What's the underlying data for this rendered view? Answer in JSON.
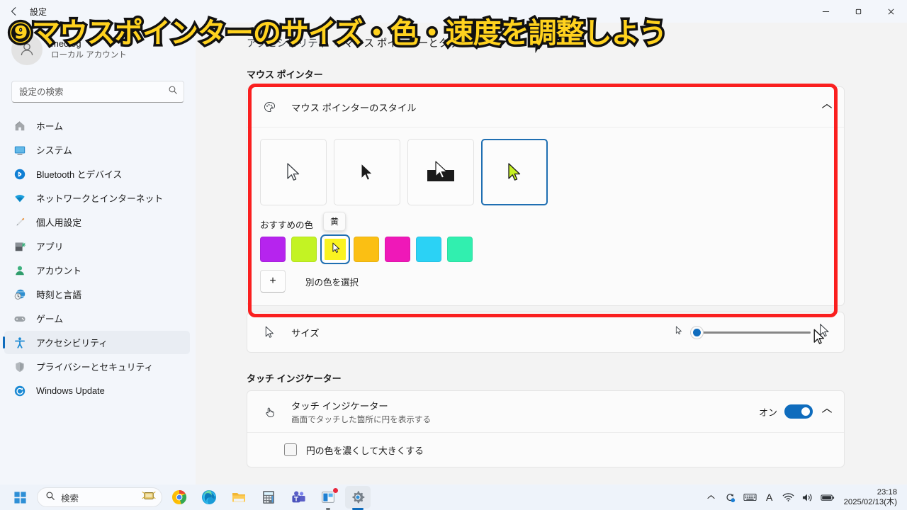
{
  "window": {
    "title": "設定",
    "back_icon": "back-arrow-icon",
    "controls": {
      "minimize": "—",
      "maximize": "❐",
      "close": "✕"
    }
  },
  "overlay": {
    "title": "⑨マウスポインターのサイズ・色・速度を調整しよう",
    "text_color": "#ffd21e",
    "stroke_color": "#111111"
  },
  "annotation": {
    "box_color": "#fa1f1f"
  },
  "sidebar": {
    "account": {
      "name": "meolog",
      "type": "ローカル アカウント",
      "avatar_icon": "person-avatar-icon"
    },
    "search": {
      "placeholder": "設定の検索",
      "value": "",
      "icon": "search-icon"
    },
    "items": [
      {
        "label": "ホーム",
        "icon": "home-icon",
        "active": false
      },
      {
        "label": "システム",
        "icon": "system-icon",
        "active": false
      },
      {
        "label": "Bluetooth とデバイス",
        "icon": "bluetooth-icon",
        "active": false
      },
      {
        "label": "ネットワークとインターネット",
        "icon": "network-icon",
        "active": false
      },
      {
        "label": "個人用設定",
        "icon": "personalization-icon",
        "active": false
      },
      {
        "label": "アプリ",
        "icon": "apps-icon",
        "active": false
      },
      {
        "label": "アカウント",
        "icon": "accounts-icon",
        "active": false
      },
      {
        "label": "時刻と言語",
        "icon": "time-language-icon",
        "active": false
      },
      {
        "label": "ゲーム",
        "icon": "gaming-icon",
        "active": false
      },
      {
        "label": "アクセシビリティ",
        "icon": "accessibility-icon",
        "active": true
      },
      {
        "label": "プライバシーとセキュリティ",
        "icon": "privacy-shield-icon",
        "active": false
      },
      {
        "label": "Windows Update",
        "icon": "windows-update-icon",
        "active": false
      }
    ]
  },
  "breadcrumb": {
    "parent": "アクセシビリティ",
    "separator": "›",
    "current": "マウス ポインターとタッチ"
  },
  "main": {
    "section_mouse_pointer": {
      "title": "マウス ポインター",
      "style_card": {
        "icon": "palette-icon",
        "title": "マウス ポインターのスタイル",
        "expand_chevron": "chevron-up-icon",
        "tiles": [
          {
            "name": "white-pointer",
            "selected": false
          },
          {
            "name": "black-pointer",
            "selected": false
          },
          {
            "name": "inverted-pointer",
            "selected": false
          },
          {
            "name": "custom-color-pointer",
            "selected": true
          }
        ],
        "colors_label": "おすすめの色",
        "tooltip": "黄",
        "swatches": [
          {
            "name": "purple",
            "hex": "#B624EE",
            "selected": false
          },
          {
            "name": "yellow-green",
            "hex": "#C3F323",
            "selected": false
          },
          {
            "name": "yellow",
            "hex": "#FAF321",
            "selected": true
          },
          {
            "name": "amber",
            "hex": "#FBBF13",
            "selected": false
          },
          {
            "name": "magenta",
            "hex": "#EF18B8",
            "selected": false
          },
          {
            "name": "cyan",
            "hex": "#2BD2F5",
            "selected": false
          },
          {
            "name": "spring-green",
            "hex": "#31EFAF",
            "selected": false
          }
        ],
        "pick_other": {
          "plus": "+",
          "label": "別の色を選択"
        }
      },
      "size_row": {
        "icon": "pointer-size-icon",
        "title": "サイズ",
        "slider": {
          "value": 1,
          "min": 1,
          "max": 15
        },
        "small_icon": "small-pointer-icon",
        "large_icon": "large-pointer-icon"
      }
    },
    "section_touch_indicator": {
      "title": "タッチ インジケーター",
      "row": {
        "icon": "touch-hand-icon",
        "title": "タッチ インジケーター",
        "subtitle": "画面でタッチした箇所に円を表示する",
        "toggle_label": "オン",
        "toggle_on": true,
        "expand_chevron": "chevron-up-icon"
      },
      "checkbox_row": {
        "label": "円の色を濃くして大きくする",
        "checked": false
      }
    }
  },
  "taskbar": {
    "start_icon": "windows-start-icon",
    "search": {
      "text": "検索",
      "icon": "search-icon",
      "right_icon": "highlight-icon"
    },
    "apps": [
      {
        "name": "chrome-icon",
        "running": false,
        "active": false,
        "badge": false
      },
      {
        "name": "edge-icon",
        "running": false,
        "active": false,
        "badge": false
      },
      {
        "name": "file-explorer-icon",
        "running": false,
        "active": false,
        "badge": false
      },
      {
        "name": "calculator-icon",
        "running": false,
        "active": false,
        "badge": false
      },
      {
        "name": "teams-icon",
        "running": false,
        "active": false,
        "badge": false
      },
      {
        "name": "microsoft-store-icon",
        "running": true,
        "active": false,
        "badge": true
      },
      {
        "name": "settings-icon",
        "running": false,
        "active": true,
        "badge": false
      }
    ],
    "tray": {
      "chevron": "show-hidden-icons-chevron",
      "icons": [
        "onedrive-sync-icon",
        "ime-keyboard-icon",
        "ime-mode-a-icon",
        "wifi-icon",
        "volume-icon",
        "battery-icon"
      ],
      "ime_letter": "A",
      "time": "23:18",
      "date": "2025/02/13(木)"
    }
  },
  "cursors": {
    "big_pointer_right_of_card": "pointer-cursor",
    "pointer_on_swatch": "pointer-cursor"
  }
}
